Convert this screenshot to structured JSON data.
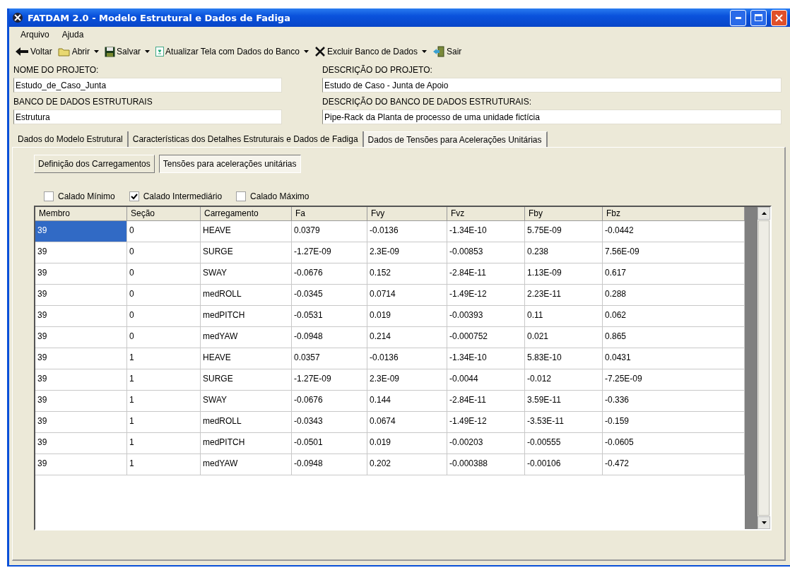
{
  "window": {
    "title": "FATDAM 2.0 -  Modelo Estrutural e Dados de Fadiga"
  },
  "menu": [
    "Arquivo",
    "Ajuda"
  ],
  "toolbar": [
    {
      "label": "Voltar",
      "kind": "back",
      "dropdown": false
    },
    {
      "label": "Abrir",
      "kind": "open",
      "dropdown": true
    },
    {
      "label": "Salvar",
      "kind": "save",
      "dropdown": true
    },
    {
      "label": "Atualizar Tela com Dados do Banco",
      "kind": "refresh",
      "dropdown": true
    },
    {
      "label": "Excluir Banco de Dados",
      "kind": "delete",
      "dropdown": true
    },
    {
      "label": "Sair",
      "kind": "exit",
      "dropdown": false
    }
  ],
  "fields": [
    {
      "label": "NOME DO PROJETO:",
      "value": "Estudo_de_Caso_Junta"
    },
    {
      "label": "DESCRIÇÃO DO PROJETO:",
      "value": "Estudo de Caso - Junta de Apoio"
    },
    {
      "label": "BANCO DE DADOS ESTRUTURAIS",
      "value": "Estrutura"
    },
    {
      "label": "DESCRIÇÃO DO BANCO DE DADOS ESTRUTURAIS:",
      "value": "Pipe-Rack da Planta de processo de uma unidade fictícia"
    }
  ],
  "tabs": [
    {
      "label": "Dados do Modelo Estrutural",
      "selected": false
    },
    {
      "label": "Características dos Detalhes Estruturais e Dados de Fadiga",
      "selected": false
    },
    {
      "label": "Dados de Tensões para Acelerações Unitárias",
      "selected": true
    }
  ],
  "subtabs": [
    {
      "label": "Definição dos Carregamentos",
      "selected": false
    },
    {
      "label": "Tensões para acelerações unitárias",
      "selected": true
    }
  ],
  "checkboxes": [
    {
      "label": "Calado Mínimo",
      "checked": false
    },
    {
      "label": "Calado Intermediário",
      "checked": true
    },
    {
      "label": "Calado Máximo",
      "checked": false
    }
  ],
  "table": {
    "columns": [
      "Membro",
      "Seção",
      "Carregamento",
      "Fa",
      "Fvy",
      "Fvz",
      "Fby",
      "Fbz"
    ],
    "rows": [
      {
        "selected": true,
        "cells": [
          "39",
          "0",
          "HEAVE",
          "0.0379",
          "-0.0136",
          "-1.34E-10",
          "5.75E-09",
          "-0.0442"
        ]
      },
      {
        "selected": false,
        "cells": [
          "39",
          "0",
          "SURGE",
          "-1.27E-09",
          "2.3E-09",
          "-0.00853",
          "0.238",
          "7.56E-09"
        ]
      },
      {
        "selected": false,
        "cells": [
          "39",
          "0",
          "SWAY",
          "-0.0676",
          "0.152",
          "-2.84E-11",
          "1.13E-09",
          "0.617"
        ]
      },
      {
        "selected": false,
        "cells": [
          "39",
          "0",
          "medROLL",
          "-0.0345",
          "0.0714",
          "-1.49E-12",
          "2.23E-11",
          "0.288"
        ]
      },
      {
        "selected": false,
        "cells": [
          "39",
          "0",
          "medPITCH",
          "-0.0531",
          "0.019",
          "-0.00393",
          "0.11",
          "0.062"
        ]
      },
      {
        "selected": false,
        "cells": [
          "39",
          "0",
          "medYAW",
          "-0.0948",
          "0.214",
          "-0.000752",
          "0.021",
          "0.865"
        ]
      },
      {
        "selected": false,
        "cells": [
          "39",
          "1",
          "HEAVE",
          "0.0357",
          "-0.0136",
          "-1.34E-10",
          "5.83E-10",
          "0.0431"
        ]
      },
      {
        "selected": false,
        "cells": [
          "39",
          "1",
          "SURGE",
          "-1.27E-09",
          "2.3E-09",
          "-0.0044",
          "-0.012",
          "-7.25E-09"
        ]
      },
      {
        "selected": false,
        "cells": [
          "39",
          "1",
          "SWAY",
          "-0.0676",
          "0.144",
          "-2.84E-11",
          "3.59E-11",
          "-0.336"
        ]
      },
      {
        "selected": false,
        "cells": [
          "39",
          "1",
          "medROLL",
          "-0.0343",
          "0.0674",
          "-1.49E-12",
          "-3.53E-11",
          "-0.159"
        ]
      },
      {
        "selected": false,
        "cells": [
          "39",
          "1",
          "medPITCH",
          "-0.0501",
          "0.019",
          "-0.00203",
          "-0.00555",
          "-0.0605"
        ]
      },
      {
        "selected": false,
        "cells": [
          "39",
          "1",
          "medYAW",
          "-0.0948",
          "0.202",
          "-0.000388",
          "-0.00106",
          "-0.472"
        ]
      }
    ]
  }
}
